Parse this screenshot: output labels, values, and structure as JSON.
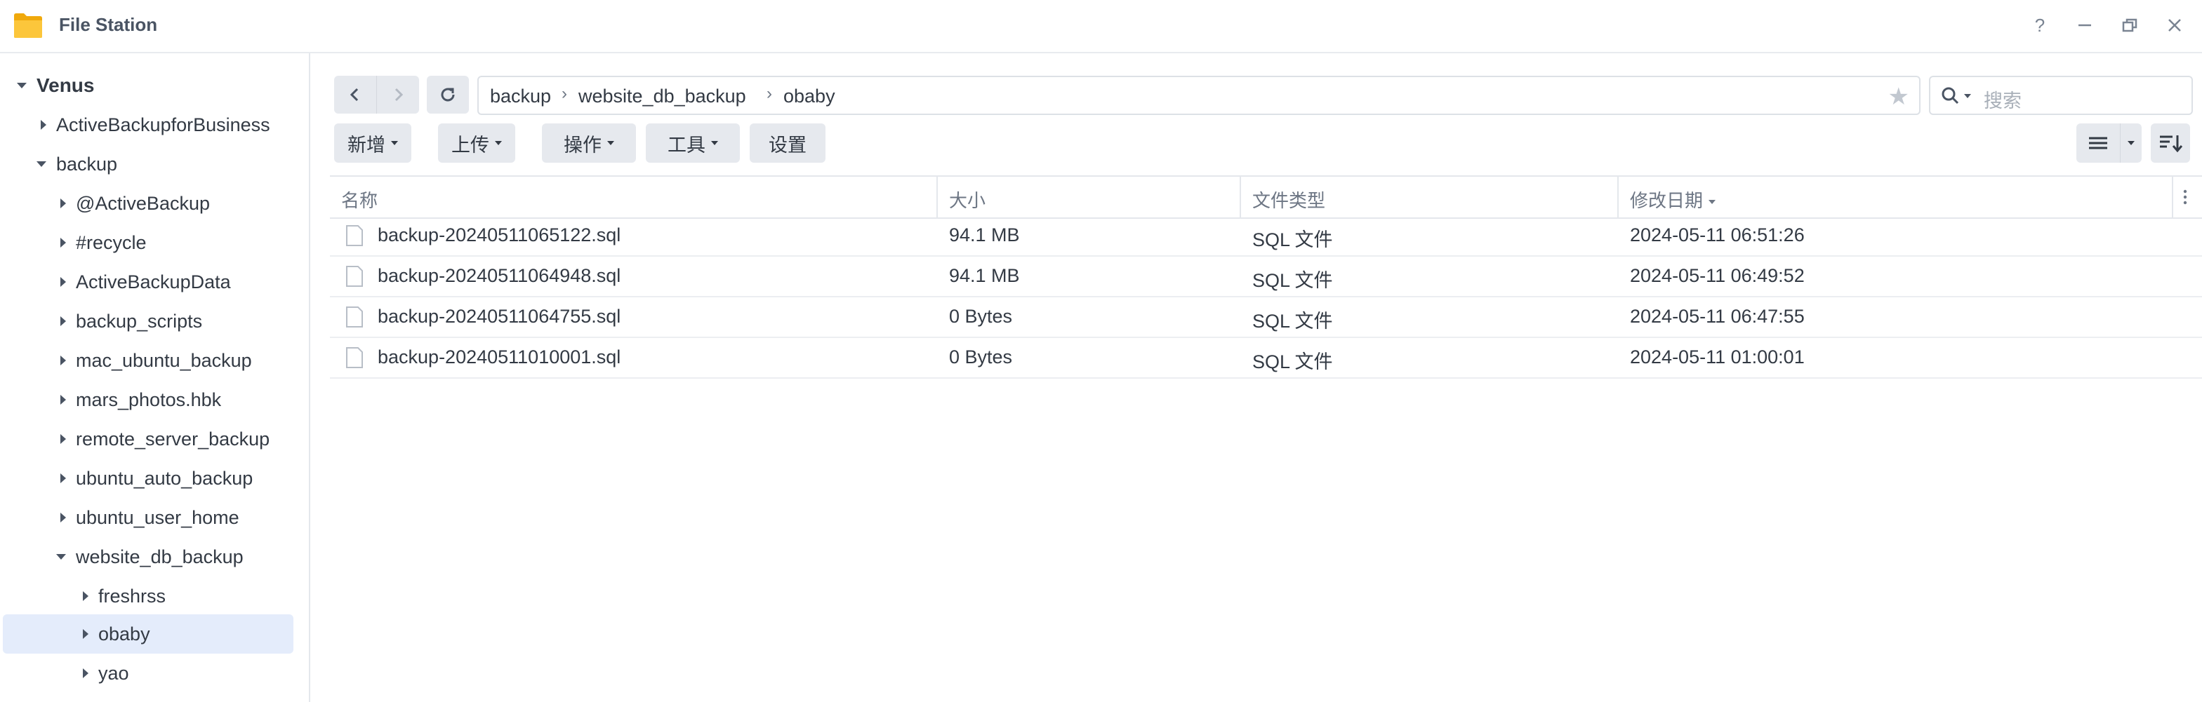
{
  "window": {
    "title": "File Station",
    "controls": [
      "help-icon",
      "minimize-icon",
      "restore-icon",
      "close-icon"
    ],
    "help_label": "?"
  },
  "sidebar": {
    "root": "Venus",
    "items": [
      {
        "label": "ActiveBackupforBusiness",
        "expanded": false
      },
      {
        "label": "backup",
        "expanded": true
      },
      {
        "label": "@ActiveBackup",
        "expanded": false
      },
      {
        "label": "#recycle",
        "expanded": false
      },
      {
        "label": "ActiveBackupData",
        "expanded": false
      },
      {
        "label": "backup_scripts",
        "expanded": false
      },
      {
        "label": "mac_ubuntu_backup",
        "expanded": false
      },
      {
        "label": "mars_photos.hbk",
        "expanded": false
      },
      {
        "label": "remote_server_backup",
        "expanded": false
      },
      {
        "label": "ubuntu_auto_backup",
        "expanded": false
      },
      {
        "label": "ubuntu_user_home",
        "expanded": false
      },
      {
        "label": "website_db_backup",
        "expanded": true
      },
      {
        "label": "freshrss",
        "expanded": false
      },
      {
        "label": "obaby",
        "expanded": false,
        "selected": true
      },
      {
        "label": "yao",
        "expanded": false
      }
    ]
  },
  "path": {
    "crumbs": [
      "backup",
      "website_db_backup",
      "obaby"
    ]
  },
  "search": {
    "placeholder": "搜索"
  },
  "toolbar": {
    "new_label": "新增",
    "upload_label": "上传",
    "action_label": "操作",
    "tools_label": "工具",
    "settings_label": "设置"
  },
  "table": {
    "headers": {
      "name": "名称",
      "size": "大小",
      "type": "文件类型",
      "modified": "修改日期"
    },
    "rows": [
      {
        "name": "backup-20240511065122.sql",
        "size": "94.1 MB",
        "type": "SQL 文件",
        "modified": "2024-05-11 06:51:26"
      },
      {
        "name": "backup-20240511064948.sql",
        "size": "94.1 MB",
        "type": "SQL 文件",
        "modified": "2024-05-11 06:49:52"
      },
      {
        "name": "backup-20240511064755.sql",
        "size": "0 Bytes",
        "type": "SQL 文件",
        "modified": "2024-05-11 06:47:55"
      },
      {
        "name": "backup-20240511010001.sql",
        "size": "0 Bytes",
        "type": "SQL 文件",
        "modified": "2024-05-11 01:00:01"
      }
    ]
  },
  "colors": {
    "accent": "#f5a623",
    "selection": "#e4ecfb",
    "button_bg": "#e6e9ee"
  }
}
